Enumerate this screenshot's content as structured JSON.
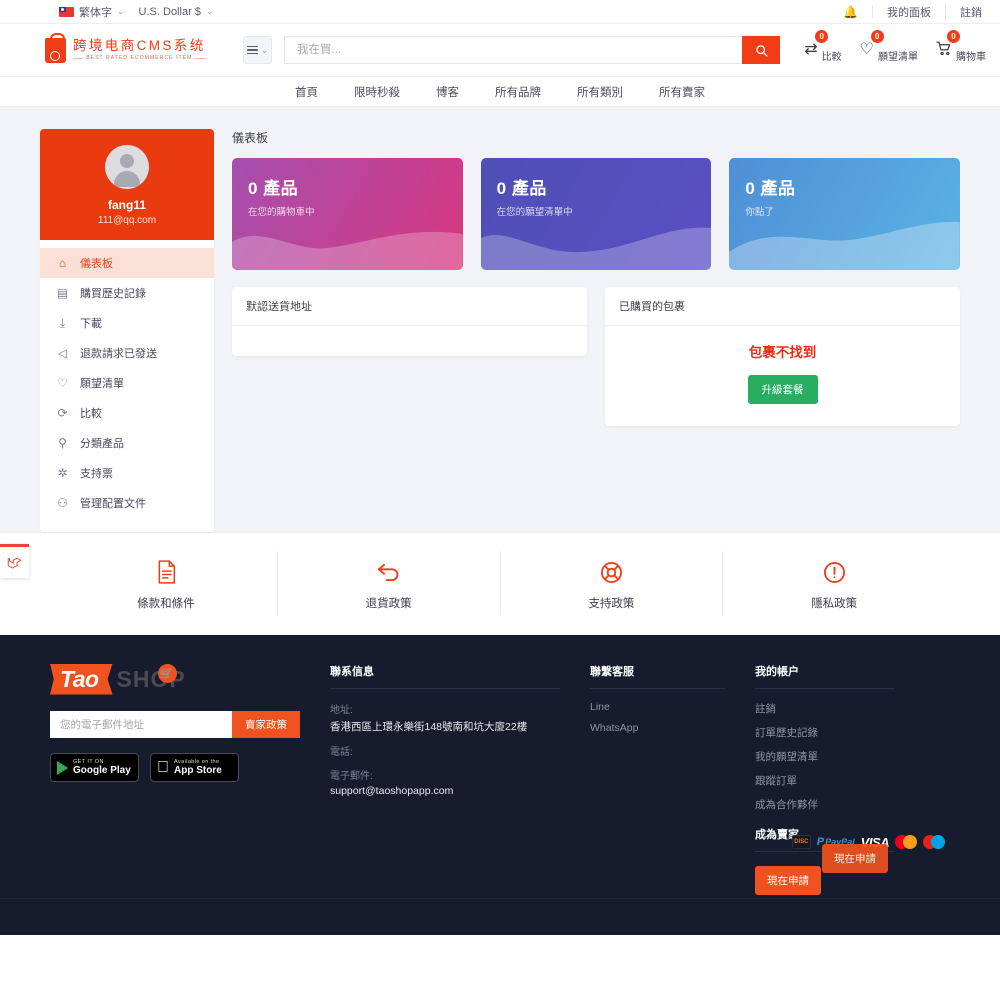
{
  "topbar": {
    "language": "繁体字",
    "currency": "U.S. Dollar $",
    "bell_icon": "bell-icon",
    "my_panel": "我的面板",
    "logout": "註銷"
  },
  "header": {
    "logo_main": "跨境电商CMS系统",
    "logo_sub": "BEST RATED ECOMMERCE ITEM",
    "category_icon": "hamburger-icon",
    "search_placeholder": "我在買...",
    "search_value": "",
    "search_icon": "search-icon",
    "icons": [
      {
        "name": "compare",
        "icon": "compare-icon",
        "glyph": "⇄",
        "count": "0",
        "label": "比較"
      },
      {
        "name": "wishlist",
        "icon": "heart-icon",
        "glyph": "♡",
        "count": "0",
        "label": "願望清單"
      },
      {
        "name": "cart",
        "icon": "cart-icon",
        "glyph": "🛒",
        "count": "0",
        "label": "購物車"
      }
    ]
  },
  "nav": {
    "items": [
      {
        "label": "首頁"
      },
      {
        "label": "限時秒殺"
      },
      {
        "label": "博客"
      },
      {
        "label": "所有品牌"
      },
      {
        "label": "所有類別"
      },
      {
        "label": "所有賣家"
      }
    ]
  },
  "sidebar": {
    "username": "fang11",
    "email": "111@qq.com",
    "avatar": "user-avatar",
    "items": [
      {
        "label": "儀表板",
        "icon": "home-icon",
        "glyph": "⌂",
        "active": true
      },
      {
        "label": "購買歷史記錄",
        "icon": "document-icon",
        "glyph": "▤",
        "active": false
      },
      {
        "label": "下載",
        "icon": "download-icon",
        "glyph": "⤓",
        "active": false
      },
      {
        "label": "退款請求已發送",
        "icon": "megaphone-icon",
        "glyph": "◁",
        "active": false
      },
      {
        "label": "願望清單",
        "icon": "heart-icon",
        "glyph": "♡",
        "active": false
      },
      {
        "label": "比較",
        "icon": "compare-icon",
        "glyph": "⟳",
        "active": false
      },
      {
        "label": "分類產品",
        "icon": "pin-icon",
        "glyph": "⚲",
        "active": false
      },
      {
        "label": "支持票",
        "icon": "gear-icon",
        "glyph": "✲",
        "active": false
      },
      {
        "label": "管理配置文件",
        "icon": "person-icon",
        "glyph": "⚇",
        "active": false
      }
    ]
  },
  "dashboard": {
    "title": "儀表板",
    "cards": [
      {
        "number": "0 產品",
        "caption": "在您的購物車中",
        "color": "#d8377f",
        "theme": "pink"
      },
      {
        "number": "0 產品",
        "caption": "在您的願望清單中",
        "color": "#5b4fc4",
        "theme": "purple"
      },
      {
        "number": "0 產品",
        "caption": "你點了",
        "color": "#5bb3e4",
        "theme": "blue"
      }
    ],
    "address_panel": {
      "title": "默認送貨地址",
      "body": ""
    },
    "package_panel": {
      "title": "已購買的包裹",
      "not_found": "包裹不找到",
      "upgrade_label": "升級套餐",
      "upgrade_color": "#27ae60"
    }
  },
  "policies": [
    {
      "label": "條款和條件",
      "icon": "document-icon"
    },
    {
      "label": "退貨政策",
      "icon": "return-arrow-icon"
    },
    {
      "label": "支持政策",
      "icon": "lifebuoy-icon"
    },
    {
      "label": "隱私政策",
      "icon": "exclamation-circle-icon"
    }
  ],
  "footer": {
    "logo_tao": "Tao",
    "logo_shop": "SHOP",
    "logo_cart_icon": "cart-icon",
    "subscribe_placeholder": "您的電子郵件地址",
    "subscribe_value": "",
    "subscribe_button": "賣家政策",
    "stores": [
      {
        "small": "GET IT ON",
        "big": "Google Play",
        "icon": "google-play-icon"
      },
      {
        "small": "Available on the",
        "big": "App Store",
        "icon": "apple-icon"
      }
    ],
    "contact": {
      "heading": "聯系信息",
      "address_label": "地址:",
      "address_value": "香港西區上環永樂街148號南和坑大廈22樓",
      "phone_label": "電話:",
      "phone_value": "",
      "email_label": "電子郵件:",
      "email_value": "support@taoshopapp.com"
    },
    "support": {
      "heading": "聯繫客服",
      "links": [
        {
          "label": "Line"
        },
        {
          "label": "WhatsApp"
        }
      ]
    },
    "account": {
      "heading": "我的帳户",
      "links": [
        {
          "label": "註銷"
        },
        {
          "label": "訂單歷史記錄"
        },
        {
          "label": "我的願望清單"
        },
        {
          "label": "跟蹤訂單"
        },
        {
          "label": "成為合作夥伴"
        }
      ],
      "seller_heading": "成為賣家",
      "apply_label": "現在申請",
      "apply_color": "#f0521f"
    },
    "payments": [
      {
        "name": "discover-icon",
        "label": "DISC"
      },
      {
        "name": "paypal-icon",
        "label": "PayPal"
      },
      {
        "name": "visa-icon",
        "label": "VISA"
      },
      {
        "name": "mastercard-icon",
        "label": ""
      },
      {
        "name": "maestro-icon",
        "label": ""
      }
    ],
    "ghost_apply_label": "現在申請"
  },
  "laravel_tab": {
    "icon": "laravel-icon"
  }
}
